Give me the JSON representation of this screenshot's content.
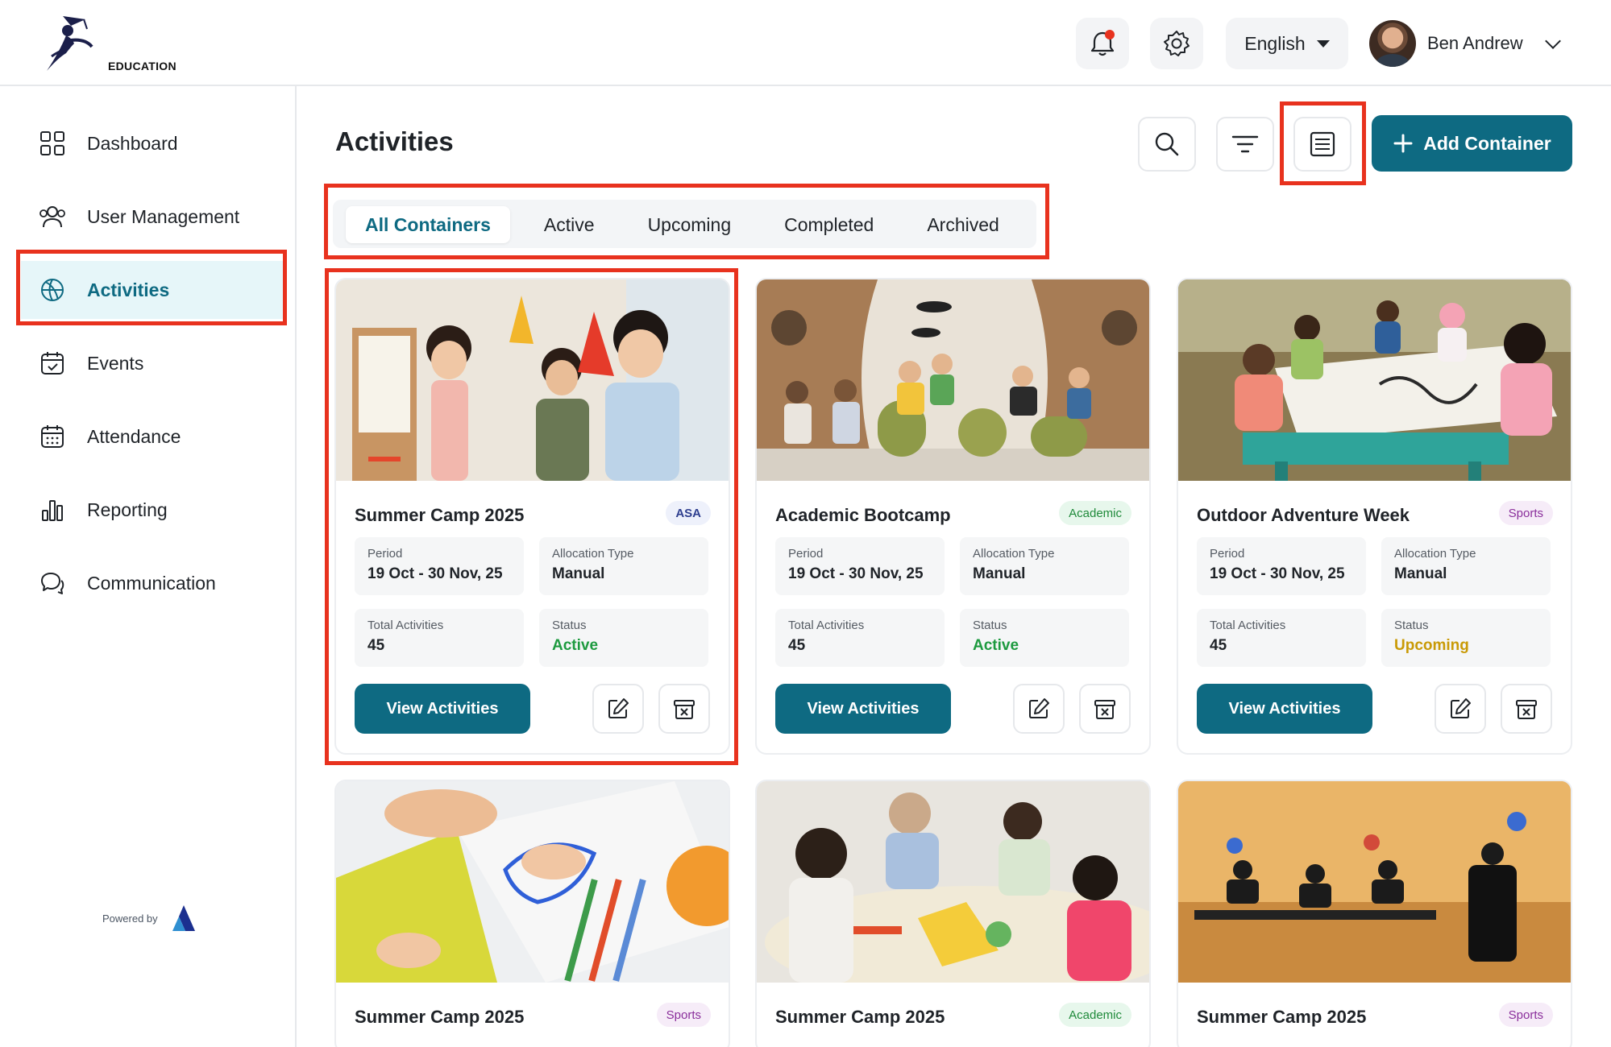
{
  "brand": {
    "logo_text": "EDUCATION",
    "powered_by": "Powered by"
  },
  "header": {
    "language": "English",
    "user_name": "Ben Andrew",
    "notification_dot_color": "#e8321e"
  },
  "sidebar": {
    "items": [
      {
        "label": "Dashboard",
        "icon": "dashboard-icon",
        "active": false
      },
      {
        "label": "User Management",
        "icon": "users-icon",
        "active": false
      },
      {
        "label": "Activities",
        "icon": "basketball-icon",
        "active": true
      },
      {
        "label": "Events",
        "icon": "calendar-check-icon",
        "active": false
      },
      {
        "label": "Attendance",
        "icon": "calendar-grid-icon",
        "active": false
      },
      {
        "label": "Reporting",
        "icon": "bar-chart-icon",
        "active": false
      },
      {
        "label": "Communication",
        "icon": "chat-icon",
        "active": false
      }
    ]
  },
  "main": {
    "title": "Activities",
    "add_button_label": "Add Container",
    "tabs": [
      "All Containers",
      "Active",
      "Upcoming",
      "Completed",
      "Archived"
    ],
    "active_tab": "All Containers",
    "labels": {
      "period": "Period",
      "allocation_type": "Allocation Type",
      "total_activities": "Total Activities",
      "status": "Status",
      "view_button": "View Activities"
    },
    "cards": [
      {
        "title": "Summer Camp 2025",
        "badge": "ASA",
        "period": "19 Oct - 30 Nov, 25",
        "allocation": "Manual",
        "total": "45",
        "status": "Active"
      },
      {
        "title": "Academic Bootcamp",
        "badge": "Academic",
        "period": "19 Oct - 30 Nov, 25",
        "allocation": "Manual",
        "total": "45",
        "status": "Active"
      },
      {
        "title": "Outdoor Adventure Week",
        "badge": "Sports",
        "period": "19 Oct - 30 Nov, 25",
        "allocation": "Manual",
        "total": "45",
        "status": "Upcoming"
      },
      {
        "title": "Summer Camp 2025",
        "badge": "Sports"
      },
      {
        "title": "Summer Camp 2025",
        "badge": "Academic"
      },
      {
        "title": "Summer Camp 2025",
        "badge": "Sports"
      }
    ]
  },
  "colors": {
    "primary": "#0e6a82",
    "highlight": "#e8321e",
    "active_status": "#1d9a3f",
    "upcoming_status": "#c99a06"
  }
}
